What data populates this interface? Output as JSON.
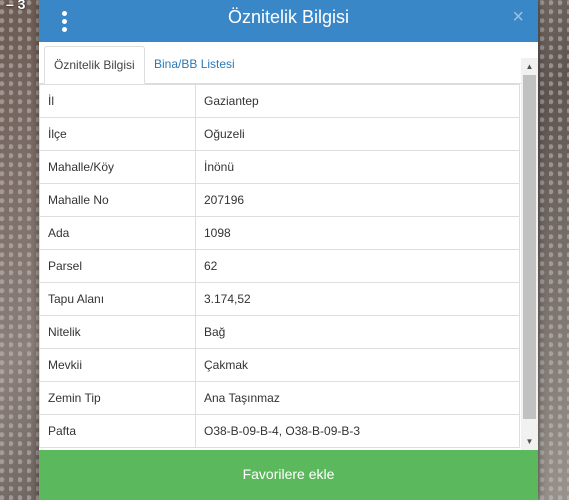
{
  "background": {
    "map_label": "– 3"
  },
  "dialog": {
    "title": "Öznitelik Bilgisi",
    "close_label": "×",
    "tabs": [
      {
        "label": "Öznitelik Bilgisi",
        "active": true
      },
      {
        "label": "Bina/BB Listesi",
        "active": false
      }
    ],
    "rows": [
      {
        "key": "İl",
        "value": "Gaziantep"
      },
      {
        "key": "İlçe",
        "value": "Oğuzeli"
      },
      {
        "key": "Mahalle/Köy",
        "value": "İnönü"
      },
      {
        "key": "Mahalle No",
        "value": "207196"
      },
      {
        "key": "Ada",
        "value": "1098"
      },
      {
        "key": "Parsel",
        "value": "62"
      },
      {
        "key": "Tapu Alanı",
        "value": "3.174,52"
      },
      {
        "key": "Nitelik",
        "value": "Bağ"
      },
      {
        "key": "Mevkii",
        "value": "Çakmak"
      },
      {
        "key": "Zemin Tip",
        "value": "Ana Taşınmaz"
      },
      {
        "key": "Pafta",
        "value": "O38-B-09-B-4, O38-B-09-B-3"
      }
    ],
    "footer_button": "Favorilere ekle"
  },
  "colors": {
    "header": "#3a87c8",
    "footer": "#5cb85c",
    "tab_link": "#2a7ab8"
  },
  "icons": {
    "menu": "vertical-dots-icon",
    "close": "close-icon",
    "scroll_up": "triangle-up-icon",
    "scroll_down": "triangle-down-icon"
  }
}
